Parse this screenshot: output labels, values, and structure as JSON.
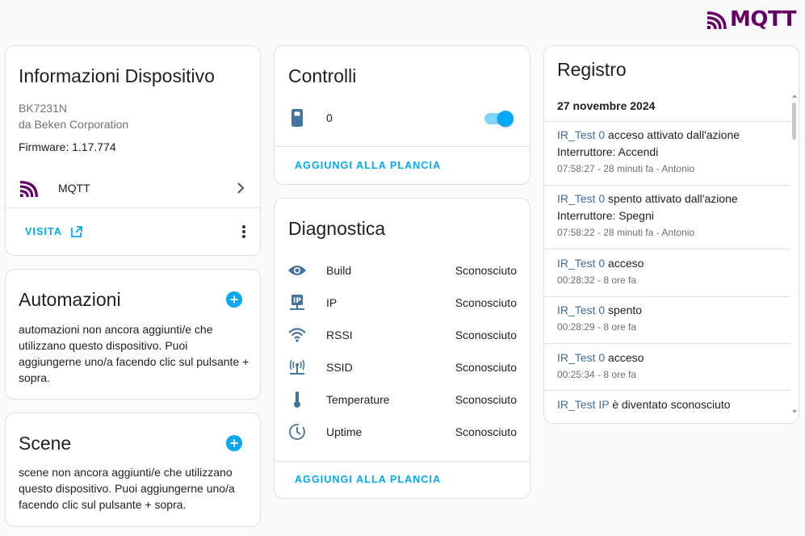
{
  "brand": {
    "name": "MQTT",
    "color": "#660066"
  },
  "device_info": {
    "title": "Informazioni Dispositivo",
    "model": "BK7231N",
    "manufacturer": "da Beken Corporation",
    "firmware": "Firmware: 1.17.774",
    "integration": "MQTT",
    "visit_label": "VISITA"
  },
  "automations": {
    "title": "Automazioni",
    "text": "automazioni non ancora aggiunti/e che utilizzano questo dispositivo. Puoi aggiungerne uno/a facendo clic sul pulsante + sopra."
  },
  "scenes": {
    "title": "Scene",
    "text": "scene non ancora aggiunti/e che utilizzano questo dispositivo. Puoi aggiungerne uno/a facendo clic sul pulsante + sopra."
  },
  "controls": {
    "title": "Controlli",
    "entity_name": "0",
    "toggle_on": true,
    "add_label": "AGGIUNGI ALLA PLANCIA"
  },
  "diagnostics": {
    "title": "Diagnostica",
    "rows": [
      {
        "icon": "eye-icon",
        "label": "Build",
        "value": "Sconosciuto"
      },
      {
        "icon": "ip-network-icon",
        "label": "IP",
        "value": "Sconosciuto"
      },
      {
        "icon": "wifi-icon",
        "label": "RSSI",
        "value": "Sconosciuto"
      },
      {
        "icon": "access-point-icon",
        "label": "SSID",
        "value": "Sconosciuto"
      },
      {
        "icon": "thermometer-icon",
        "label": "Temperature",
        "value": "Sconosciuto"
      },
      {
        "icon": "clock-outline-icon",
        "label": "Uptime",
        "value": "Sconosciuto"
      }
    ],
    "add_label": "AGGIUNGI ALLA PLANCIA"
  },
  "logbook": {
    "title": "Registro",
    "date": "27 novembre 2024",
    "entries": [
      {
        "entity": "IR_Test 0",
        "line1": " acceso attivato dall'azione",
        "line2": "Interruttore: Accendi",
        "time": "07:58:27 - 28 minuti fa - Antonio"
      },
      {
        "entity": "IR_Test 0",
        "line1": " spento attivato dall'azione",
        "line2": "Interruttore: Spegni",
        "time": "07:58:22 - 28 minuti fa - Antonio"
      },
      {
        "entity": "IR_Test 0",
        "line1": " acceso",
        "line2": "",
        "time": "00:28:32 - 8 ore fa"
      },
      {
        "entity": "IR_Test 0",
        "line1": " spento",
        "line2": "",
        "time": "00:28:29 - 8 ore fa"
      },
      {
        "entity": "IR_Test 0",
        "line1": " acceso",
        "line2": "",
        "time": "00:25:34 - 8 ore fa"
      },
      {
        "entity": "IR_Test IP",
        "line1": " è diventato sconosciuto",
        "line2": "",
        "time": ""
      }
    ]
  }
}
